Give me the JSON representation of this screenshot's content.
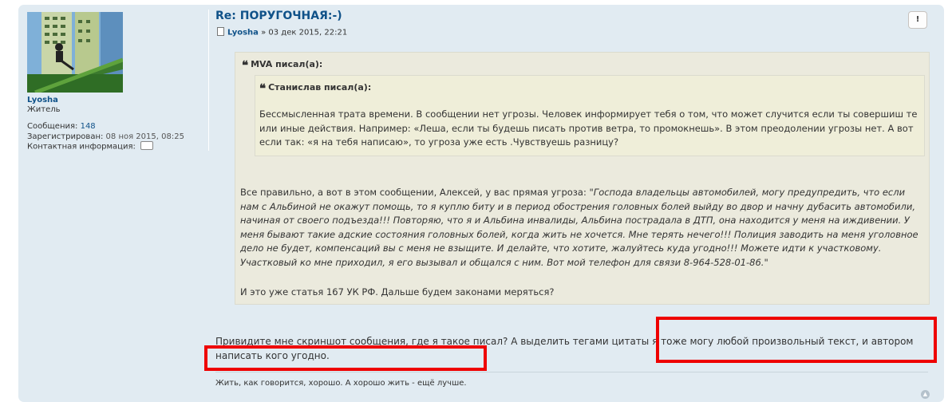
{
  "post": {
    "title": "Re: ПОРУГОЧНАЯ:-)",
    "author": "Lyosha",
    "meta_separator": " » ",
    "date": "03 дек 2015, 22:21",
    "report_label": "!"
  },
  "profile": {
    "username": "Lyosha",
    "rank": "Житель",
    "posts_label": "Сообщения:",
    "posts_count": "148",
    "registered_label": "Зарегистрирован:",
    "registered_date": "08 ноя 2015, 08:25",
    "contact_label": "Контактная информация:"
  },
  "quote_outer": {
    "cite": "MVA писал(а):",
    "text_plain": "Все правильно, а вот в этом сообщении, Алексей, у вас прямая угроза: ",
    "text_italic": "\"Господа владельцы автомобилей, могу предупредить, что если нам с Альбиной не окажут помощь, то я куплю биту и в период обострения головных болей выйду во двор и начну дубасить автомобили, начиная от своего подъезда!!! Повторяю, что я и Альбина инвалиды, Альбина пострадала в ДТП, она находится у меня на иждивении. У меня бывают такие адские состояния головных болей, когда жить не хочется. Мне терять нечего!!! Полиция заводить на меня уголовное дело не будет, компенсаций вы с меня не взыщите. И делайте, что хотите, жалуйтесь куда угодно!!! Можете идти к участковому. Участковый ко мне приходил, я его вызывал и общался с ним. Вот мой телефон для связи 8-964-528-01-86.\"",
    "closing": "И это уже статья 167 УК РФ. Дальше будем законами меряться?"
  },
  "quote_inner": {
    "cite": "Станислав писал(а):",
    "text": "Бессмысленная трата времени. В сообщении нет угрозы. Человек информирует тебя о том, что может случится если ты совершиш те или иные действия. Например: «Леша, если ты будешь писать против ветра, то промокнешь». В этом преодолении угрозы нет. А вот если так: «я на тебя написаю», то угроза уже есть .Чувствуешь разницу?"
  },
  "reply": {
    "text": "Привидите мне скриншот сообщения, где я такое писал? А выделить тегами цитаты я тоже могу любой произвольный текст, и автором написать кого угодно."
  },
  "signature": "Жить, как говорится, хорошо. А хорошо жить - ещё лучше.",
  "icons": {
    "quote_mark": "❝",
    "top": "▲"
  },
  "colors": {
    "post_bg": "#e1ebf2",
    "link": "#105289",
    "quote_bg": "#ebeadd",
    "highlight": "#ee0000"
  }
}
